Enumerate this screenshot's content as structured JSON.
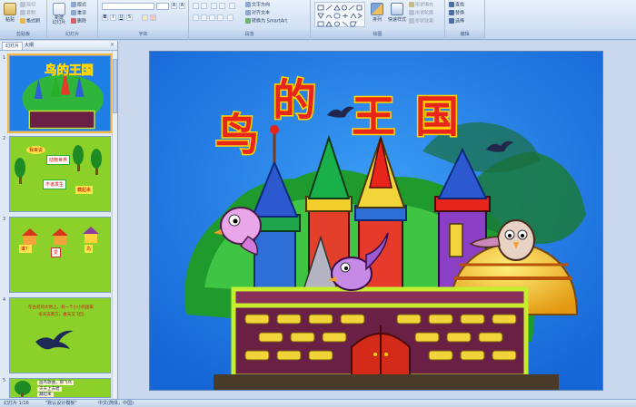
{
  "ribbon": {
    "clipboard": {
      "paste": "粘贴",
      "cut": "剪切",
      "copy": "复制",
      "format_painter": "格式刷",
      "label": "剪贴板"
    },
    "slides": {
      "new_slide": "新建\n幻灯片",
      "layout": "版式",
      "reset": "重设",
      "delete": "删除",
      "label": "幻灯片"
    },
    "font": {
      "label": "字体",
      "bold": "B",
      "italic": "I",
      "underline": "U",
      "strike": "S",
      "font_size_up": "A",
      "font_size_down": "A"
    },
    "paragraph": {
      "label": "段落",
      "text_direction": "文字方向",
      "align_text": "对齐文本",
      "smartart": "转换为 SmartArt"
    },
    "drawing": {
      "label": "绘图",
      "arrange": "排列",
      "quick_styles": "快速样式",
      "shape_fill": "形状填充",
      "shape_outline": "形状轮廓",
      "shape_effects": "形状效果"
    },
    "editing": {
      "label": "编辑",
      "find": "查找",
      "replace": "替换",
      "select": "选择"
    }
  },
  "panel": {
    "tab_slides": "幻灯片",
    "tab_outline": "大纲",
    "close": "×",
    "thumbnails": [
      {
        "num": "1",
        "title": "鸟的王国"
      },
      {
        "num": "2",
        "labels": [
          "我来说",
          "动物世界",
          "不该发生",
          "藏起来"
        ]
      },
      {
        "num": "3",
        "labels": [
          "谁？",
          "爱",
          "鸟"
        ]
      },
      {
        "num": "4",
        "labels": [
          "在古老的大地上，有一个小小的国家",
          "冬天去南方，春天又飞回"
        ]
      },
      {
        "num": "5",
        "labels": [
          "画鸟歌曲，那飞鸟",
          "天天上去唱",
          "藏起来"
        ]
      }
    ]
  },
  "slide": {
    "title_chars": [
      "鸟",
      "的",
      "王",
      "国"
    ]
  },
  "status": {
    "slide_info": "幻灯片 1/16",
    "theme": "\"默认设计模板\"",
    "language": "中文(简体，中国)"
  },
  "colors": {
    "slide_bg": "#1f7fe7",
    "title_red": "#e8251b",
    "title_outline": "#ffd400",
    "wall": "#6a1f45",
    "brick": "#f2d53a",
    "thumb_green": "#8cd12a"
  }
}
